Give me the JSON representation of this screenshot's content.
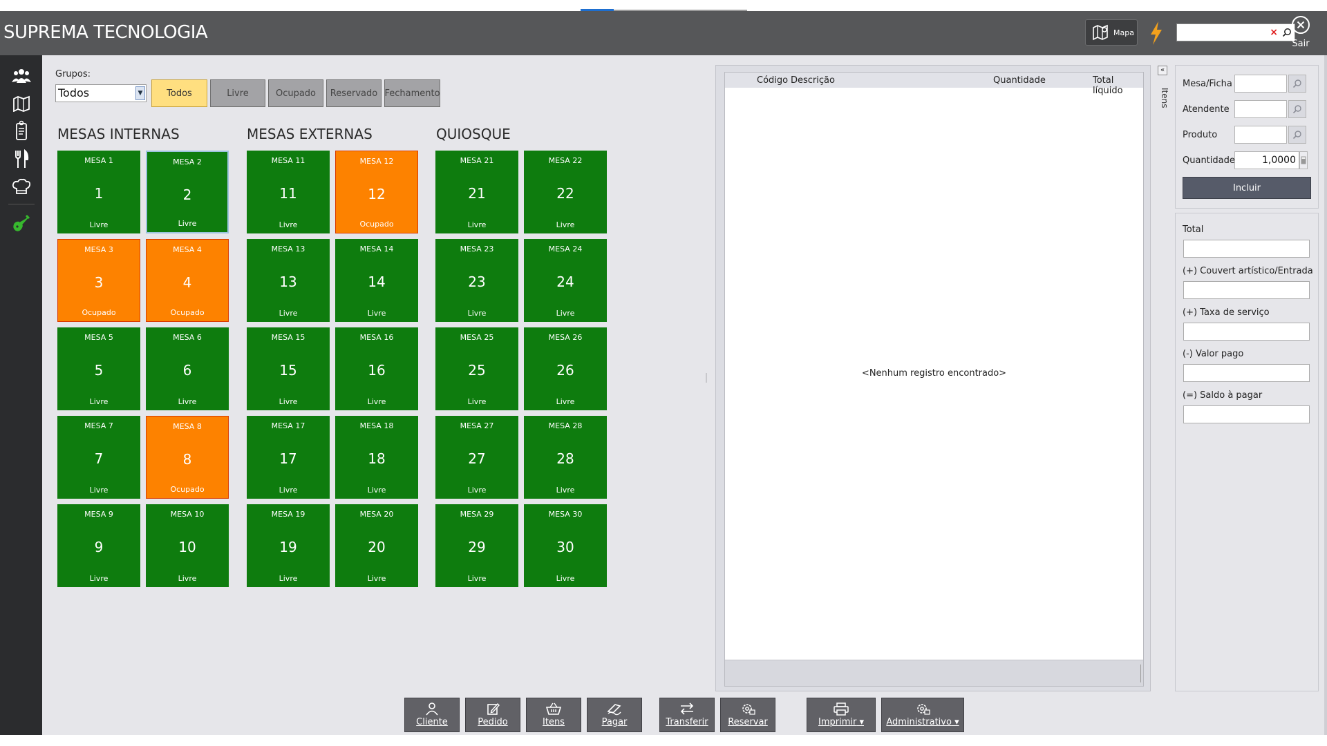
{
  "app": {
    "title": "SUPREMA TECNOLOGIA",
    "map_label": "Mapa",
    "exit_label": "Sair",
    "search_value": ""
  },
  "filters": {
    "grupos_label": "Grupos:",
    "grupos_selected": "Todos",
    "buttons": [
      {
        "label": "Todos",
        "active": true
      },
      {
        "label": "Livre",
        "active": false
      },
      {
        "label": "Ocupado",
        "active": false
      },
      {
        "label": "Reservado",
        "active": false
      },
      {
        "label": "Fechamento",
        "active": false
      }
    ]
  },
  "sections": [
    {
      "title": "MESAS INTERNAS",
      "tables": [
        {
          "name": "MESA 1",
          "num": "1",
          "status": "Livre"
        },
        {
          "name": "MESA 2",
          "num": "2",
          "status": "Livre",
          "selected": true
        },
        {
          "name": "MESA 3",
          "num": "3",
          "status": "Ocupado"
        },
        {
          "name": "MESA 4",
          "num": "4",
          "status": "Ocupado"
        },
        {
          "name": "MESA 5",
          "num": "5",
          "status": "Livre"
        },
        {
          "name": "MESA 6",
          "num": "6",
          "status": "Livre"
        },
        {
          "name": "MESA 7",
          "num": "7",
          "status": "Livre"
        },
        {
          "name": "MESA 8",
          "num": "8",
          "status": "Ocupado"
        },
        {
          "name": "MESA 9",
          "num": "9",
          "status": "Livre"
        },
        {
          "name": "MESA 10",
          "num": "10",
          "status": "Livre"
        }
      ]
    },
    {
      "title": "MESAS EXTERNAS",
      "tables": [
        {
          "name": "MESA 11",
          "num": "11",
          "status": "Livre"
        },
        {
          "name": "MESA 12",
          "num": "12",
          "status": "Ocupado"
        },
        {
          "name": "MESA 13",
          "num": "13",
          "status": "Livre"
        },
        {
          "name": "MESA 14",
          "num": "14",
          "status": "Livre"
        },
        {
          "name": "MESA 15",
          "num": "15",
          "status": "Livre"
        },
        {
          "name": "MESA 16",
          "num": "16",
          "status": "Livre"
        },
        {
          "name": "MESA 17",
          "num": "17",
          "status": "Livre"
        },
        {
          "name": "MESA 18",
          "num": "18",
          "status": "Livre"
        },
        {
          "name": "MESA 19",
          "num": "19",
          "status": "Livre"
        },
        {
          "name": "MESA 20",
          "num": "20",
          "status": "Livre"
        }
      ]
    },
    {
      "title": "QUIOSQUE",
      "tables": [
        {
          "name": "MESA 21",
          "num": "21",
          "status": "Livre"
        },
        {
          "name": "MESA 22",
          "num": "22",
          "status": "Livre"
        },
        {
          "name": "MESA 23",
          "num": "23",
          "status": "Livre"
        },
        {
          "name": "MESA 24",
          "num": "24",
          "status": "Livre"
        },
        {
          "name": "MESA 25",
          "num": "25",
          "status": "Livre"
        },
        {
          "name": "MESA 26",
          "num": "26",
          "status": "Livre"
        },
        {
          "name": "MESA 27",
          "num": "27",
          "status": "Livre"
        },
        {
          "name": "MESA 28",
          "num": "28",
          "status": "Livre"
        },
        {
          "name": "MESA 29",
          "num": "29",
          "status": "Livre"
        },
        {
          "name": "MESA 30",
          "num": "30",
          "status": "Livre"
        }
      ]
    }
  ],
  "items": {
    "columns": [
      "Código",
      "Descrição",
      "Quantidade",
      "Total líquido"
    ],
    "empty_message": "<Nenhum registro encontrado>",
    "side_tab": "Itens",
    "collapse": "«"
  },
  "form": {
    "mesa_label": "Mesa/Ficha",
    "mesa_value": "",
    "atendente_label": "Atendente",
    "atendente_value": "",
    "produto_label": "Produto",
    "produto_value": "",
    "quantidade_label": "Quantidade",
    "quantidade_value": "1,0000",
    "incluir_label": "Incluir"
  },
  "totals": {
    "total_label": "Total",
    "couvert_label": "(+) Couvert artístico/Entrada",
    "taxa_label": "(+) Taxa de serviço",
    "pago_label": "(-) Valor pago",
    "saldo_label": "(=) Saldo à pagar",
    "total_value": "",
    "couvert_value": "",
    "taxa_value": "",
    "pago_value": "",
    "saldo_value": ""
  },
  "actions": {
    "cliente": "Cliente",
    "pedido": "Pedido",
    "itens": "Itens",
    "pagar": "Pagar",
    "transferir": "Transferir",
    "reservar": "Reservar",
    "imprimir": "Imprimir",
    "administrativo": "Administrativo"
  },
  "colors": {
    "free": "#0e7c0e",
    "busy": "#fd8200",
    "active_filter": "#ffdf80",
    "titlebar": "#565759",
    "accent_bolt": "#f2a11d",
    "active_side_icon": "#37b82e"
  }
}
